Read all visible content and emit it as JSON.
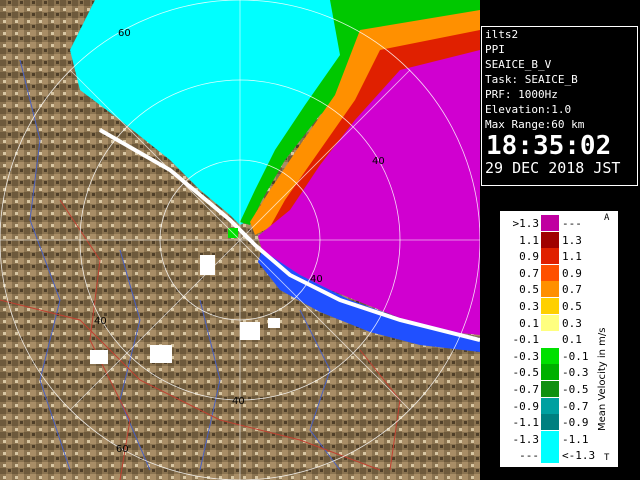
{
  "panel": {
    "lines": [
      "ilts2",
      "PPI",
      "SEAICE_B_V",
      "Task: SEAICE_B",
      "PRF: 1000Hz",
      "Elevation:1.0",
      "Max Range:60 km"
    ],
    "time": "18:35:02",
    "date": "29 DEC 2018 JST"
  },
  "range_labels": [
    "60",
    "40",
    "40",
    "40",
    "40",
    "60"
  ],
  "legend": {
    "unit": "Mean Velocity in m/s",
    "top_mark": "A",
    "bottom_mark": "T",
    "rows": [
      {
        "lo": ">1.3",
        "hi": "---",
        "color": "#c000a0"
      },
      {
        "lo": "1.1",
        "hi": "1.3",
        "color": "#a00000"
      },
      {
        "lo": "0.9",
        "hi": "1.1",
        "color": "#e02000"
      },
      {
        "lo": "0.7",
        "hi": "0.9",
        "color": "#ff5000"
      },
      {
        "lo": "0.5",
        "hi": "0.7",
        "color": "#ff9000"
      },
      {
        "lo": "0.3",
        "hi": "0.5",
        "color": "#ffd000"
      },
      {
        "lo": "0.1",
        "hi": "0.3",
        "color": "#ffff80"
      },
      {
        "lo": "-0.1",
        "hi": "0.1",
        "color": "#ffffff"
      },
      {
        "lo": "-0.3",
        "hi": "-0.1",
        "color": "#00e000"
      },
      {
        "lo": "-0.5",
        "hi": "-0.3",
        "color": "#00b000"
      },
      {
        "lo": "-0.7",
        "hi": "-0.5",
        "color": "#109010"
      },
      {
        "lo": "-0.9",
        "hi": "-0.7",
        "color": "#00a0a0"
      },
      {
        "lo": "-1.1",
        "hi": "-0.9",
        "color": "#008080"
      },
      {
        "lo": "-1.3",
        "hi": "-1.1",
        "color": "#00ffff"
      },
      {
        "lo": "---",
        "hi": "<-1.3",
        "color": "#00ffff"
      }
    ]
  }
}
